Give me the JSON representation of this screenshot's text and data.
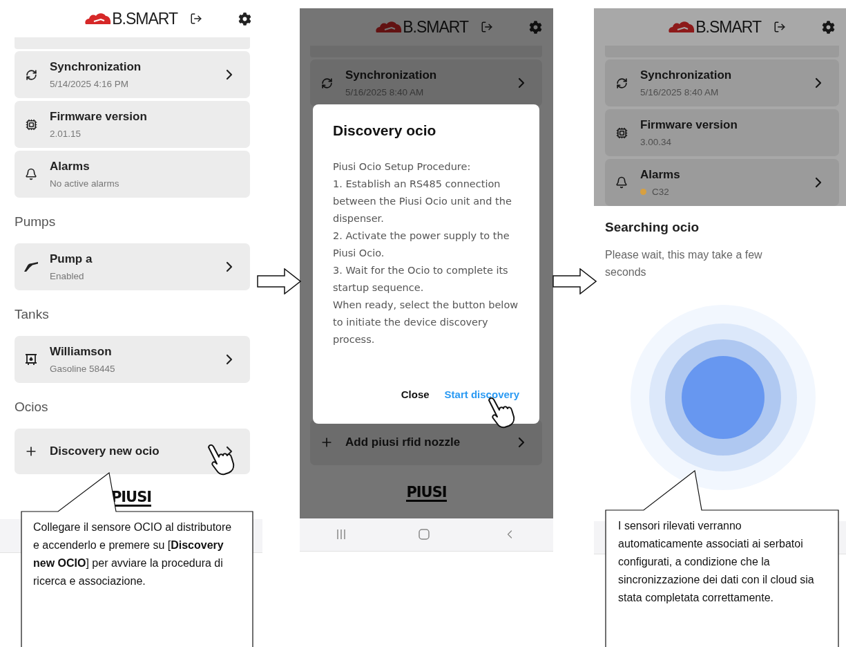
{
  "panels": [
    {
      "kind": "list",
      "header": {
        "logo": "B.SMART"
      },
      "rows": [
        {
          "kind": "sync",
          "title": "Synchronization",
          "subtitle": "5/14/2025 4:16 PM",
          "chevron": true
        },
        {
          "kind": "firmware",
          "title": "Firmware version",
          "subtitle": "2.01.15",
          "chevron": false
        },
        {
          "kind": "alarm",
          "title": "Alarms",
          "subtitle": "No active alarms",
          "chevron": false
        },
        {
          "kind": "heading",
          "text": "Pumps"
        },
        {
          "kind": "pump",
          "title": "Pump a",
          "subtitle": "Enabled",
          "chevron": true
        },
        {
          "kind": "heading",
          "text": "Tanks"
        },
        {
          "kind": "tank",
          "title": "Williamson",
          "subtitle": "Gasoline 58445",
          "chevron": true
        },
        {
          "kind": "heading",
          "text": "Ocios"
        },
        {
          "kind": "add",
          "title": "Discovery new ocio",
          "chevron": true,
          "touched": true
        }
      ],
      "footer_logo": "PIUSI",
      "callout": "Collegare il sensore OCIO al distributore e accenderlo e premere su [**Discovery new OCIO**] per avviare la procedura di ricerca e associazione."
    },
    {
      "kind": "dialog",
      "header": {
        "logo": "B.SMART"
      },
      "rows": [
        {
          "kind": "sync",
          "title": "Synchronization",
          "subtitle": "5/16/2025 8:40 AM",
          "chevron": true
        },
        {
          "kind": "add",
          "title": "Add piusi rfid nozzle",
          "chevron": true,
          "touched": false
        }
      ],
      "footer_logo": "PIUSI",
      "dialog": {
        "title": "Discovery ocio",
        "body": "Piusi Ocio Setup Procedure:\n1. Establish an RS485 connection between the Piusi Ocio unit and the dispenser.\n2. Activate the power supply to the Piusi Ocio.\n3. Wait for the Ocio to complete its startup sequence.\nWhen ready, select the button below to initiate the device discovery process.",
        "buttons": [
          {
            "label": "Close",
            "primary": false,
            "touched": false
          },
          {
            "label": "Start discovery",
            "primary": true,
            "touched": true
          }
        ]
      }
    },
    {
      "kind": "sheet",
      "header": {
        "logo": "B.SMART"
      },
      "rows": [
        {
          "kind": "sync",
          "title": "Synchronization",
          "subtitle": "5/16/2025 8:40 AM",
          "chevron": true
        },
        {
          "kind": "firmware",
          "title": "Firmware version",
          "subtitle": "3.00.34",
          "chevron": false
        },
        {
          "kind": "alarm",
          "title": "Alarms",
          "subtitle": "C32",
          "color": "#d8a040",
          "chevron": true
        }
      ],
      "sheet": {
        "title": "Searching ocio",
        "message": "Please wait, this may take a few seconds"
      },
      "callout": "I sensori rilevati verranno automaticamente associati ai serbatoi configurati, a condizione che la sincronizzazione dei dati con il cloud sia stata completata correttamente."
    }
  ]
}
